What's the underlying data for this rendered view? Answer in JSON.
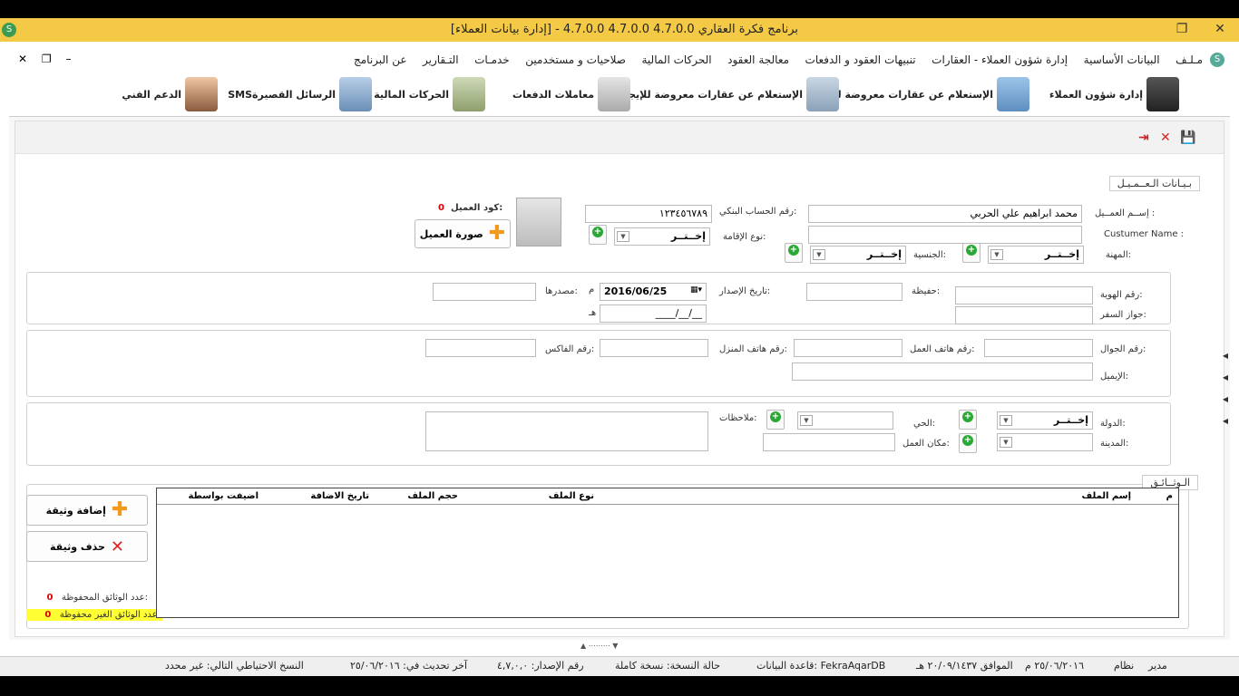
{
  "window": {
    "title": "برنامج فكرة العقاري 4.7.0.0 4.7.0.0 4.7.0.0 - [إدارة بيانات العملاء]"
  },
  "menu": [
    "مـلـف",
    "البيانات الأساسية",
    "إدارة شؤون العملاء - العقارات",
    "تنبيهات العقود و الدفعات",
    "معالجة العقود",
    "الحركات المالية",
    "صلاحيات و مستخدمين",
    "خدمـات",
    "التـقارير",
    "عن البرنامج"
  ],
  "toolbar": [
    {
      "label": "إدارة شؤون العملاء",
      "icon": "user-manager-icon"
    },
    {
      "label": "الإستعلام عن عقارات معروضة للبيع",
      "icon": "house-icon"
    },
    {
      "label": "الإستعلام عن عقارات معروضة للإيجار",
      "icon": "building-icon"
    },
    {
      "label": "معاملات الدفعات",
      "icon": "calculator-icon"
    },
    {
      "label": "الحركات المالية",
      "icon": "money-icon"
    },
    {
      "label": "الرسائل القصيرةSMS",
      "icon": "mobile-icon"
    },
    {
      "label": "الدعم الفني",
      "icon": "support-icon"
    }
  ],
  "customer": {
    "legend": "بـيـانات الـعــمـيـل",
    "name_label": "إســم العمــيل :",
    "name_value": "محمد ابراهيم علي الحربي",
    "cname_label": "Custumer Name :",
    "cname_value": "",
    "job_label": "المهنة:",
    "nat_label": "الجنسية:",
    "bank_label": "رقم الحساب البنكي:",
    "bank_value": "١٢٣٤٥٦٧٨٩",
    "residence_label": "نوع الإقامة:",
    "choose": "إخــتــر",
    "code_label": "كود العميل:",
    "code_value": "0",
    "photo_btn": "صورة العميل"
  },
  "id": {
    "id_label": "رقم الهوية:",
    "passport_label": "جواز السفر:",
    "file_label": "حفيظة:",
    "issue_label": "تاريخ الإصدار:",
    "issue_date": "2016/06/25",
    "greg_mark": "م",
    "hijri_mark": "هـ",
    "hijri_date": "__/__/____",
    "source_label": "مصدرها:"
  },
  "contact": {
    "mobile_label": "رقم الجوال:",
    "work_phone_label": "رقم هاتف العمل:",
    "home_phone_label": "رقم هاتف المنزل:",
    "fax_label": "رقم الفاكس:",
    "email_label": "الإيميل:"
  },
  "address": {
    "country_label": "الدولة:",
    "city_label": "المدينة:",
    "district_label": "الحي:",
    "workplace_label": "مكان العمل:",
    "notes_label": "ملاحظات:"
  },
  "docs": {
    "legend": "الـوثــائـق",
    "cols": [
      "م",
      "إسم الملف",
      "نوع الملف",
      "حجم الملف",
      "تاريخ الاضافة",
      "اضيفت بواسطة"
    ],
    "add_btn": "إضافة وثيقة",
    "del_btn": "حذف وثيقة",
    "saved_label": "عدد الوثائق المحفوظة:",
    "saved_value": "0",
    "unsaved_label": "عدد الوثائق الغير محفوظة:",
    "unsaved_value": "0"
  },
  "status": {
    "backup": "النسخ الاحتياطي التالي: غير محدد",
    "last_update": "آخر تحديث في: ٢٥/٠٦/٢٠١٦",
    "version": "رقم الإصدار: ٤,٧,٠,٠",
    "copy_state": "حالة النسخة: نسخة كاملة",
    "db": "قاعدة البيانات: FekraAqarDB",
    "hijri": "الموافق ٢٠/٠٩/١٤٣٧ هـ",
    "greg": "٢٥/٠٦/٢٠١٦ م",
    "system": "نظام",
    "manager": "مدير"
  }
}
